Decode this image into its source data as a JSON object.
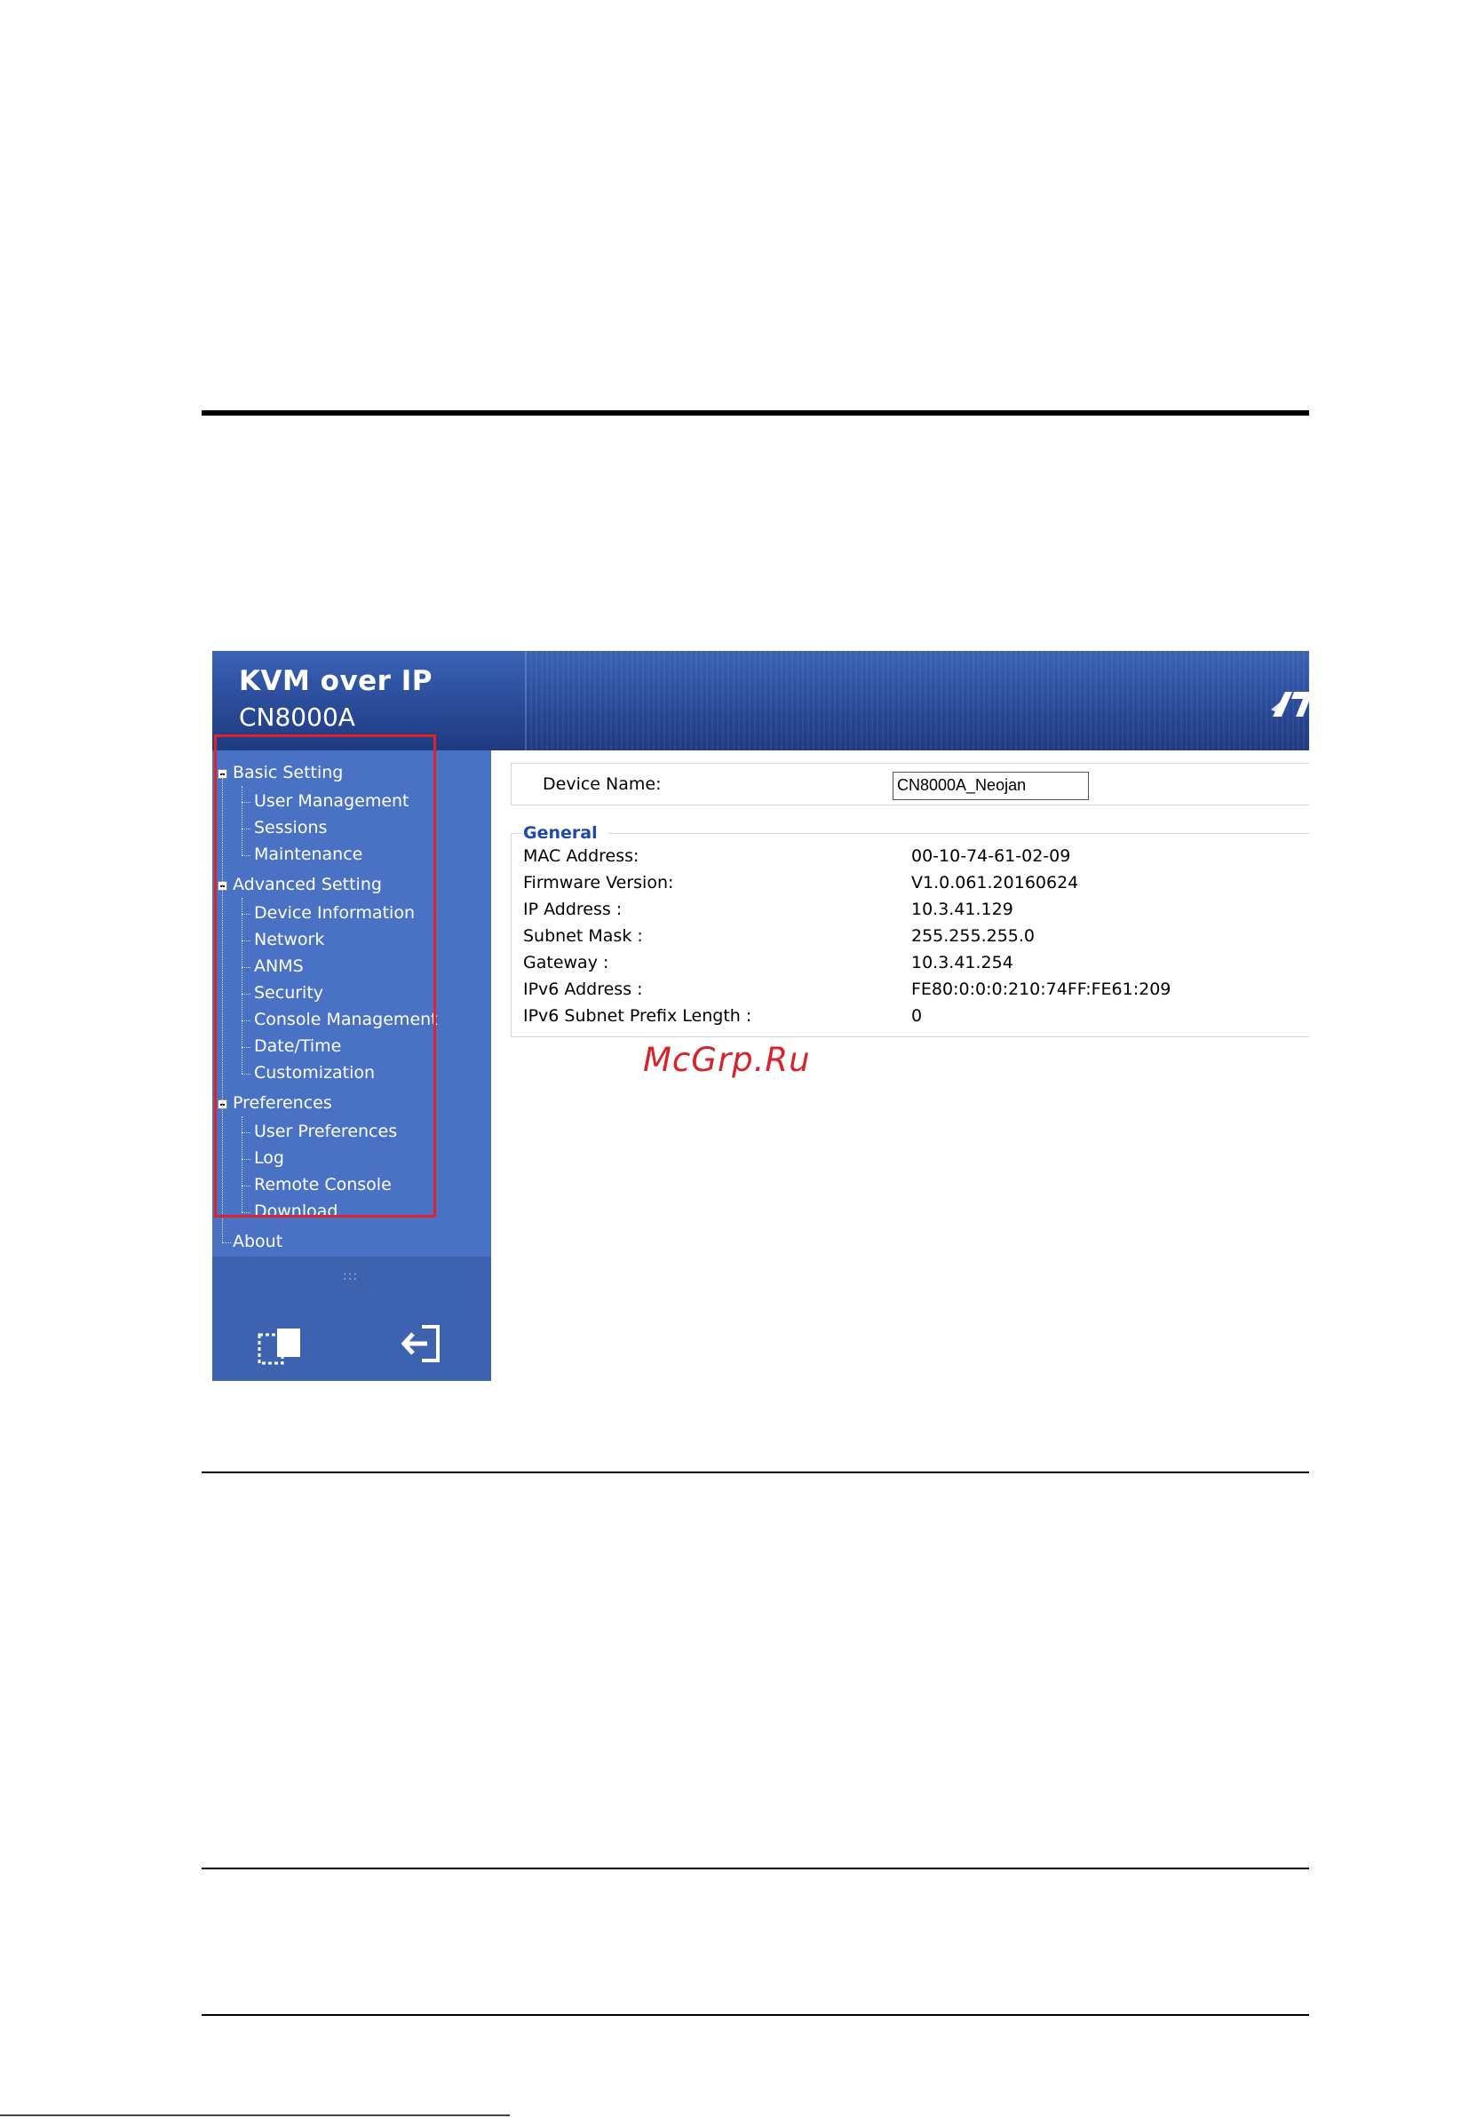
{
  "header": {
    "title": "KVM over IP",
    "subtitle": "CN8000A"
  },
  "sidebar": {
    "groups": [
      {
        "label": "Basic Setting",
        "items": [
          "User Management",
          "Sessions",
          "Maintenance"
        ]
      },
      {
        "label": "Advanced Setting",
        "items": [
          "Device Information",
          "Network",
          "ANMS",
          "Security",
          "Console Management",
          "Date/Time",
          "Customization"
        ]
      },
      {
        "label": "Preferences",
        "items": [
          "User Preferences",
          "Log",
          "Remote Console",
          "Download"
        ]
      }
    ],
    "about": "About",
    "grip": ":::"
  },
  "device": {
    "name_label": "Device Name:",
    "name_value": "CN8000A_Neojan"
  },
  "general": {
    "legend": "General",
    "rows": [
      {
        "label": "MAC Address:",
        "value": "00-10-74-61-02-09"
      },
      {
        "label": "Firmware Version:",
        "value": "V1.0.061.20160624"
      },
      {
        "label": "IP Address :",
        "value": "10.3.41.129"
      },
      {
        "label": "Subnet Mask :",
        "value": "255.255.255.0"
      },
      {
        "label": "Gateway :",
        "value": "10.3.41.254"
      },
      {
        "label": "IPv6 Address :",
        "value": "FE80:0:0:0:210:74FF:FE61:209"
      },
      {
        "label": "IPv6 Subnet Prefix Length :",
        "value": "0"
      }
    ]
  },
  "watermark": "McGrp.Ru",
  "colors": {
    "header": "#2d4f9e",
    "sidebar": "#4a72c4",
    "highlight": "#e0232b",
    "legend": "#1f4aa8",
    "watermark": "#d6232c"
  },
  "icons": {
    "toggle": "panel-toggle-icon",
    "logout": "logout-icon",
    "logo": "aten-logo-icon",
    "collapse": "minus-box-icon"
  }
}
